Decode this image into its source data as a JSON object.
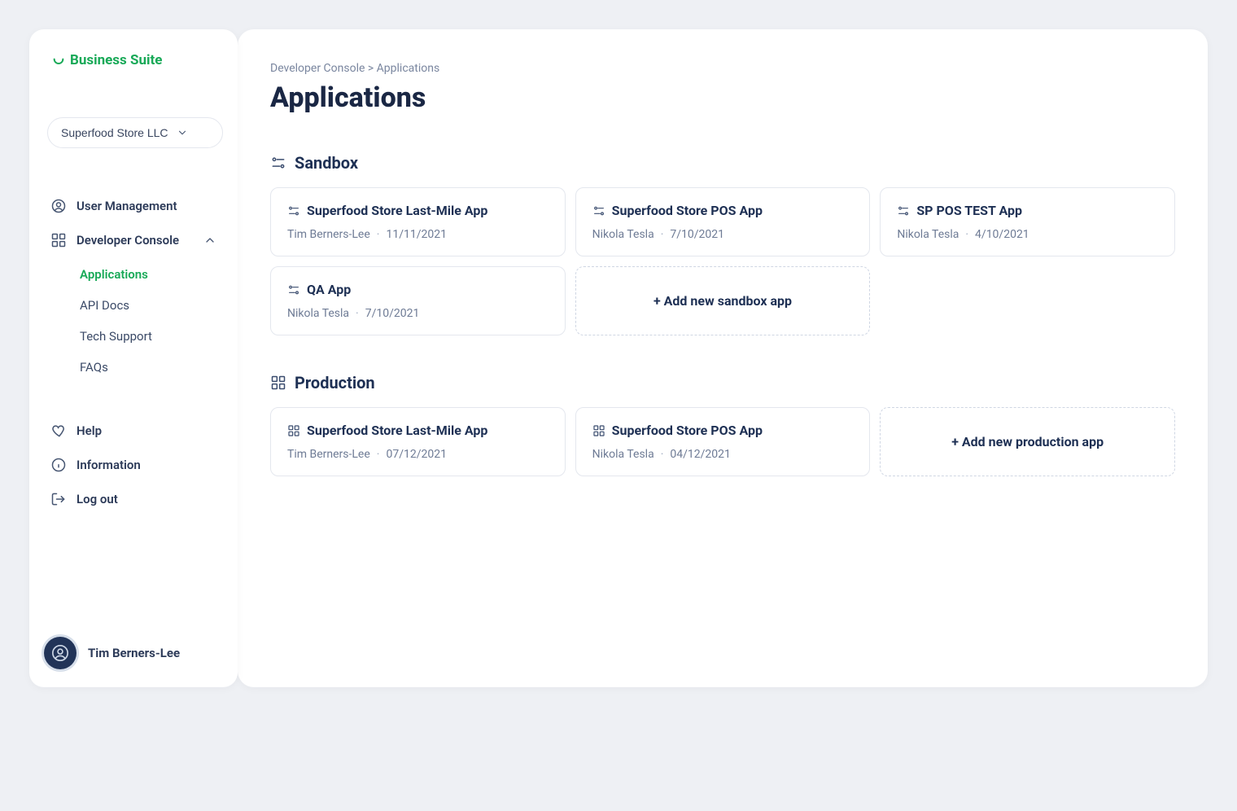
{
  "brand": {
    "name": "Business Suite"
  },
  "org": {
    "selected": "Superfood Store LLC"
  },
  "nav": {
    "user_mgmt": "User Management",
    "dev_console": "Developer Console",
    "sub": {
      "applications": "Applications",
      "api_docs": "API Docs",
      "tech_support": "Tech Support",
      "faqs": "FAQs"
    },
    "help": "Help",
    "information": "Information",
    "logout": "Log out"
  },
  "user": {
    "name": "Tim Berners-Lee"
  },
  "breadcrumb": "Developer Console > Applications",
  "title": "Applications",
  "sandbox": {
    "heading": "Sandbox",
    "add_label": "+ Add new sandbox app",
    "apps": [
      {
        "name": "Superfood Store Last-Mile App",
        "author": "Tim Berners-Lee",
        "date": "11/11/2021"
      },
      {
        "name": "Superfood Store POS App",
        "author": "Nikola Tesla",
        "date": "7/10/2021"
      },
      {
        "name": "SP POS TEST App",
        "author": "Nikola Tesla",
        "date": "4/10/2021"
      },
      {
        "name": "QA App",
        "author": "Nikola Tesla",
        "date": "7/10/2021"
      }
    ]
  },
  "production": {
    "heading": "Production",
    "add_label": "+ Add new production app",
    "apps": [
      {
        "name": "Superfood Store Last-Mile App",
        "author": "Tim Berners-Lee",
        "date": "07/12/2021"
      },
      {
        "name": "Superfood Store POS App",
        "author": "Nikola Tesla",
        "date": "04/12/2021"
      }
    ]
  }
}
